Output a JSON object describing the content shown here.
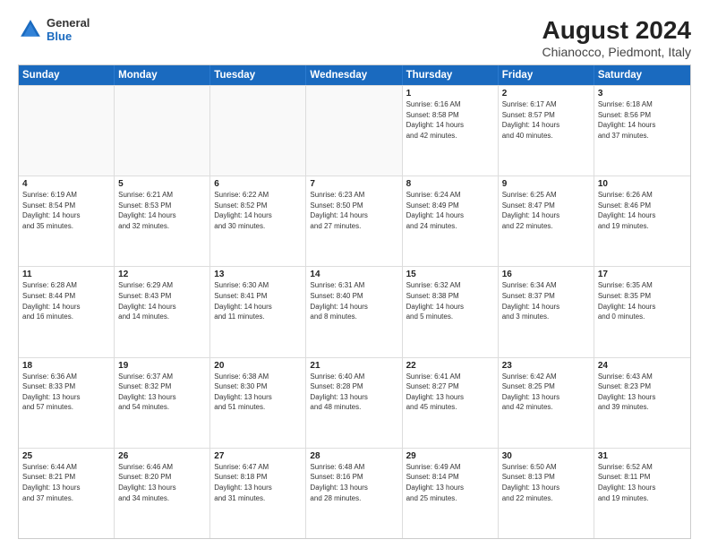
{
  "header": {
    "title": "August 2024",
    "subtitle": "Chianocco, Piedmont, Italy",
    "logo_general": "General",
    "logo_blue": "Blue"
  },
  "days_of_week": [
    "Sunday",
    "Monday",
    "Tuesday",
    "Wednesday",
    "Thursday",
    "Friday",
    "Saturday"
  ],
  "weeks": [
    [
      {
        "day": "",
        "info": ""
      },
      {
        "day": "",
        "info": ""
      },
      {
        "day": "",
        "info": ""
      },
      {
        "day": "",
        "info": ""
      },
      {
        "day": "1",
        "info": "Sunrise: 6:16 AM\nSunset: 8:58 PM\nDaylight: 14 hours\nand 42 minutes."
      },
      {
        "day": "2",
        "info": "Sunrise: 6:17 AM\nSunset: 8:57 PM\nDaylight: 14 hours\nand 40 minutes."
      },
      {
        "day": "3",
        "info": "Sunrise: 6:18 AM\nSunset: 8:56 PM\nDaylight: 14 hours\nand 37 minutes."
      }
    ],
    [
      {
        "day": "4",
        "info": "Sunrise: 6:19 AM\nSunset: 8:54 PM\nDaylight: 14 hours\nand 35 minutes."
      },
      {
        "day": "5",
        "info": "Sunrise: 6:21 AM\nSunset: 8:53 PM\nDaylight: 14 hours\nand 32 minutes."
      },
      {
        "day": "6",
        "info": "Sunrise: 6:22 AM\nSunset: 8:52 PM\nDaylight: 14 hours\nand 30 minutes."
      },
      {
        "day": "7",
        "info": "Sunrise: 6:23 AM\nSunset: 8:50 PM\nDaylight: 14 hours\nand 27 minutes."
      },
      {
        "day": "8",
        "info": "Sunrise: 6:24 AM\nSunset: 8:49 PM\nDaylight: 14 hours\nand 24 minutes."
      },
      {
        "day": "9",
        "info": "Sunrise: 6:25 AM\nSunset: 8:47 PM\nDaylight: 14 hours\nand 22 minutes."
      },
      {
        "day": "10",
        "info": "Sunrise: 6:26 AM\nSunset: 8:46 PM\nDaylight: 14 hours\nand 19 minutes."
      }
    ],
    [
      {
        "day": "11",
        "info": "Sunrise: 6:28 AM\nSunset: 8:44 PM\nDaylight: 14 hours\nand 16 minutes."
      },
      {
        "day": "12",
        "info": "Sunrise: 6:29 AM\nSunset: 8:43 PM\nDaylight: 14 hours\nand 14 minutes."
      },
      {
        "day": "13",
        "info": "Sunrise: 6:30 AM\nSunset: 8:41 PM\nDaylight: 14 hours\nand 11 minutes."
      },
      {
        "day": "14",
        "info": "Sunrise: 6:31 AM\nSunset: 8:40 PM\nDaylight: 14 hours\nand 8 minutes."
      },
      {
        "day": "15",
        "info": "Sunrise: 6:32 AM\nSunset: 8:38 PM\nDaylight: 14 hours\nand 5 minutes."
      },
      {
        "day": "16",
        "info": "Sunrise: 6:34 AM\nSunset: 8:37 PM\nDaylight: 14 hours\nand 3 minutes."
      },
      {
        "day": "17",
        "info": "Sunrise: 6:35 AM\nSunset: 8:35 PM\nDaylight: 14 hours\nand 0 minutes."
      }
    ],
    [
      {
        "day": "18",
        "info": "Sunrise: 6:36 AM\nSunset: 8:33 PM\nDaylight: 13 hours\nand 57 minutes."
      },
      {
        "day": "19",
        "info": "Sunrise: 6:37 AM\nSunset: 8:32 PM\nDaylight: 13 hours\nand 54 minutes."
      },
      {
        "day": "20",
        "info": "Sunrise: 6:38 AM\nSunset: 8:30 PM\nDaylight: 13 hours\nand 51 minutes."
      },
      {
        "day": "21",
        "info": "Sunrise: 6:40 AM\nSunset: 8:28 PM\nDaylight: 13 hours\nand 48 minutes."
      },
      {
        "day": "22",
        "info": "Sunrise: 6:41 AM\nSunset: 8:27 PM\nDaylight: 13 hours\nand 45 minutes."
      },
      {
        "day": "23",
        "info": "Sunrise: 6:42 AM\nSunset: 8:25 PM\nDaylight: 13 hours\nand 42 minutes."
      },
      {
        "day": "24",
        "info": "Sunrise: 6:43 AM\nSunset: 8:23 PM\nDaylight: 13 hours\nand 39 minutes."
      }
    ],
    [
      {
        "day": "25",
        "info": "Sunrise: 6:44 AM\nSunset: 8:21 PM\nDaylight: 13 hours\nand 37 minutes."
      },
      {
        "day": "26",
        "info": "Sunrise: 6:46 AM\nSunset: 8:20 PM\nDaylight: 13 hours\nand 34 minutes."
      },
      {
        "day": "27",
        "info": "Sunrise: 6:47 AM\nSunset: 8:18 PM\nDaylight: 13 hours\nand 31 minutes."
      },
      {
        "day": "28",
        "info": "Sunrise: 6:48 AM\nSunset: 8:16 PM\nDaylight: 13 hours\nand 28 minutes."
      },
      {
        "day": "29",
        "info": "Sunrise: 6:49 AM\nSunset: 8:14 PM\nDaylight: 13 hours\nand 25 minutes."
      },
      {
        "day": "30",
        "info": "Sunrise: 6:50 AM\nSunset: 8:13 PM\nDaylight: 13 hours\nand 22 minutes."
      },
      {
        "day": "31",
        "info": "Sunrise: 6:52 AM\nSunset: 8:11 PM\nDaylight: 13 hours\nand 19 minutes."
      }
    ]
  ]
}
